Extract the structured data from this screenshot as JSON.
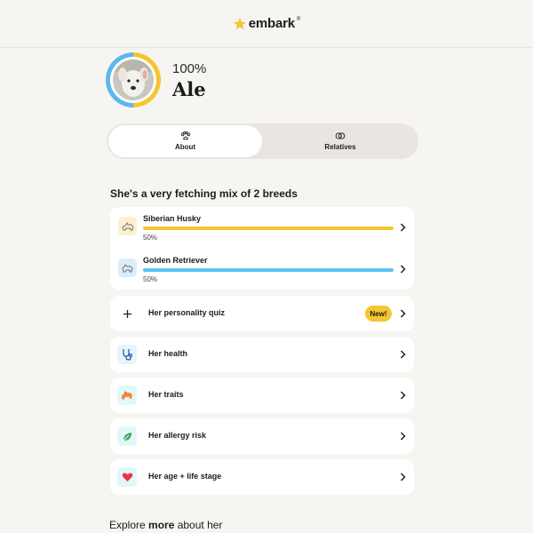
{
  "header": {
    "logo_text": "embark",
    "logo_tm": "®"
  },
  "profile": {
    "percent": "100%",
    "name": "Ale",
    "ring_colors": [
      "#f5c531",
      "#5bb8ea"
    ]
  },
  "tabs": [
    {
      "label": "About",
      "icon": "paw-icon",
      "active": true
    },
    {
      "label": "Relatives",
      "icon": "rings-icon",
      "active": false
    }
  ],
  "breeds_section": {
    "title": "She's a very fetching mix of 2 breeds",
    "breeds": [
      {
        "name": "Siberian Husky",
        "percent_label": "50%",
        "percent": 50,
        "color": "#f5c531",
        "icon_bg": "#fbf1cf",
        "icon": "husky-icon"
      },
      {
        "name": "Golden Retriever",
        "percent_label": "50%",
        "percent": 50,
        "color": "#5bc4ee",
        "icon_bg": "#d9eef9",
        "icon": "retriever-icon"
      }
    ]
  },
  "rows": [
    {
      "label": "Her personality quiz",
      "icon": "plus-icon",
      "icon_bg": "#ffffff",
      "badge": "New!"
    },
    {
      "label": "Her health",
      "icon": "stethoscope-icon",
      "icon_bg": "#e3f7f8"
    },
    {
      "label": "Her traits",
      "icon": "dog-run-icon",
      "icon_bg": "#e3f7f8"
    },
    {
      "label": "Her allergy risk",
      "icon": "leaf-icon",
      "icon_bg": "#e3f7f8"
    },
    {
      "label": "Her age + life stage",
      "icon": "heart-icon",
      "icon_bg": "#e3f7f8"
    }
  ],
  "explore": {
    "prefix": "Explore ",
    "bold": "more",
    "suffix": " about her"
  }
}
